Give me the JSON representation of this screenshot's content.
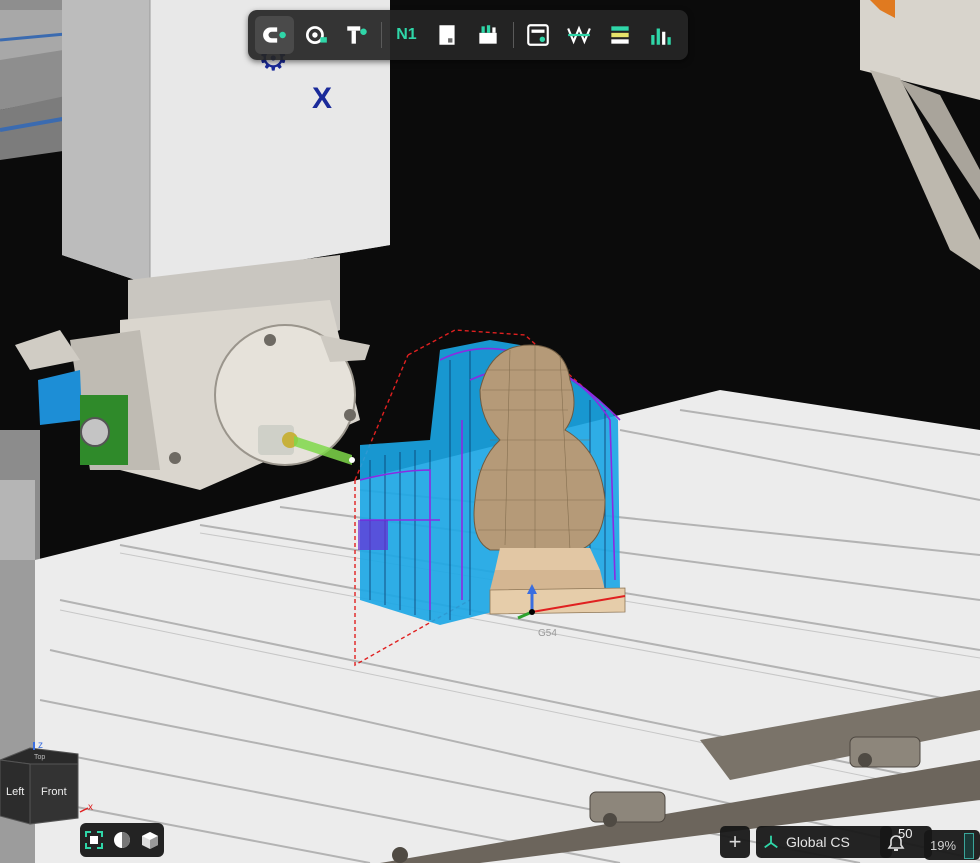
{
  "toolbar": {
    "items": [
      {
        "name": "mill-operation-icon",
        "active": true
      },
      {
        "name": "turn-operation-icon"
      },
      {
        "name": "drill-operation-icon"
      },
      {
        "name": "nc-program-label",
        "label": "N1"
      },
      {
        "name": "stock-icon"
      },
      {
        "name": "tools-icon"
      },
      {
        "name": "machine-icon"
      },
      {
        "name": "toolpath-icon"
      },
      {
        "name": "layers-icon"
      },
      {
        "name": "analysis-icon"
      }
    ]
  },
  "viewcube": {
    "face_left": "Left",
    "face_front": "Front",
    "face_top": "Top",
    "axis_z": "z",
    "axis_x": "x"
  },
  "origin_label": "G54",
  "status": {
    "add_label": "+",
    "coordinate_system": "Global CS",
    "notifications": "50",
    "zoom": "19%"
  },
  "colors": {
    "toolbar_bg": "#262626",
    "accent": "#2fd6a8",
    "toolpath_cyan": "#29b6e8",
    "toolpath_purple": "#8a2be2",
    "stock_red": "#e02020",
    "bust": "#b59a78"
  }
}
